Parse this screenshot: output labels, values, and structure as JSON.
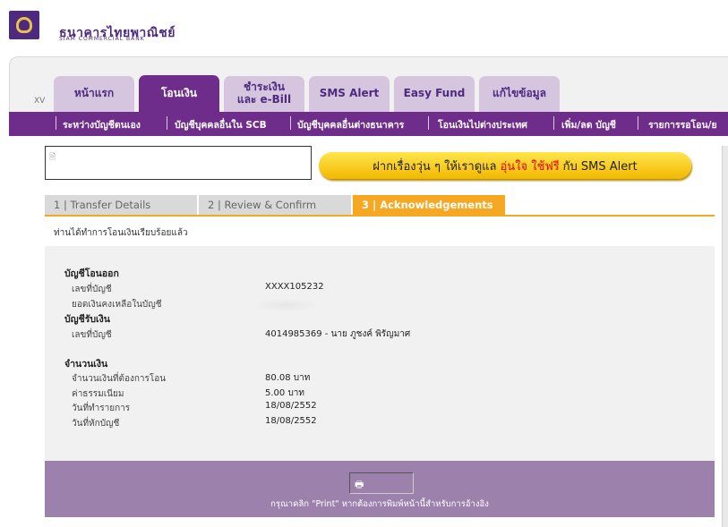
{
  "brand": {
    "name_th": "ธนาคารไทยพาณิชย์",
    "name_en": "SIAM COMMERCIAL BANK",
    "logo_color": "#4d2a7e"
  },
  "version_label": "XV",
  "tabs": [
    {
      "label": "หน้าแรก",
      "active": false
    },
    {
      "label": "โอนเงิน",
      "active": true
    },
    {
      "label": "ชำระเงิน\nและ e-Bill",
      "active": false
    },
    {
      "label": "SMS Alert",
      "active": false
    },
    {
      "label": "Easy Fund",
      "active": false
    },
    {
      "label": "แก้ไขข้อมูล",
      "active": false
    }
  ],
  "subnav": [
    "ระหว่างบัญชีตนเอง",
    "บัญชีบุคคลอื่นใน SCB",
    "บัญชีบุคคลอื่นต่างธนาคาร",
    "โอนเงินไปต่างประเทศ",
    "เพิ่ม/ลด บัญชี",
    "รายการรอโอน/ย"
  ],
  "promo": {
    "text_before": "ฝากเรื่องวุ่น ๆ ให้เราดูแล",
    "highlight": "อุ่นใจ ใช้ฟรี",
    "text_after": "กับ SMS Alert",
    "highlight_color": "#e60000"
  },
  "steps": [
    {
      "label": "1 | Transfer Details",
      "active": false
    },
    {
      "label": "2 | Review & Confirm",
      "active": false
    },
    {
      "label": "3 | Acknowledgements",
      "active": true
    }
  ],
  "success_message": "ท่านได้ทำการโอนเงินเรียบร้อยแล้ว",
  "from_account": {
    "title": "บัญชีโอนออก",
    "number_label": "เลขที่บัญชี",
    "number": "XXXX105232",
    "balance_label": "ยอดเงินคงเหลือในบัญชี"
  },
  "to_account": {
    "title": "บัญชีรับเงิน",
    "number_label": "เลขที่บัญชี",
    "number": "4014985369 - นาย ภูชงค์ พิรัญมาศ"
  },
  "amount": {
    "title": "จำนวนเงิน",
    "transfer_label": "จำนวนเงินที่ต้องการโอน",
    "transfer_value": "80.08 บาท",
    "fee_label": "ค่าธรรมเนียม",
    "fee_value": "5.00 บาท",
    "txn_date_label": "วันที่ทำรายการ",
    "txn_date": "18/08/2552",
    "debit_date_label": "วันที่หักบัญชี",
    "debit_date": "18/08/2552"
  },
  "footer": {
    "note": "กรุณาคลิก \"Print\" หากต้องการพิมพ์หน้านี้สำหรับการอ้างอิง"
  },
  "colors": {
    "primary_purple": "#6e2d8a",
    "tab_inactive": "#d6c5df",
    "step_active": "#f7a823",
    "footer_purple": "#9b81ac"
  }
}
